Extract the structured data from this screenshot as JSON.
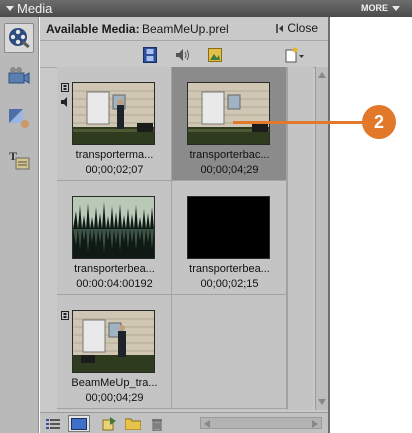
{
  "titlebar": {
    "title": "Media",
    "more_label": "MORE"
  },
  "header": {
    "label": "Available Media:",
    "filename": "BeamMeUp.prel",
    "close_label": "Close"
  },
  "media": [
    {
      "name": "transporterma...",
      "duration": "00;00;02;07",
      "type": "video",
      "has_audio": true,
      "selected": false
    },
    {
      "name": "transporterbac...",
      "duration": "00;00;04;29",
      "type": "video",
      "has_audio": false,
      "selected": true
    },
    {
      "name": "transporterbea...",
      "duration": "00:00:04:00192",
      "type": "audio",
      "has_audio": true,
      "selected": false
    },
    {
      "name": "transporterbea...",
      "duration": "00;00;02;15",
      "type": "black",
      "has_audio": false,
      "selected": false
    },
    {
      "name": "BeamMeUp_tra...",
      "duration": "00;00;04;29",
      "type": "video",
      "has_audio": false,
      "selected": false
    }
  ],
  "callout": {
    "number": "2"
  },
  "colors": {
    "accent": "#e2782a",
    "panel": "#c9c9c9",
    "selected": "#8b8b8b"
  }
}
